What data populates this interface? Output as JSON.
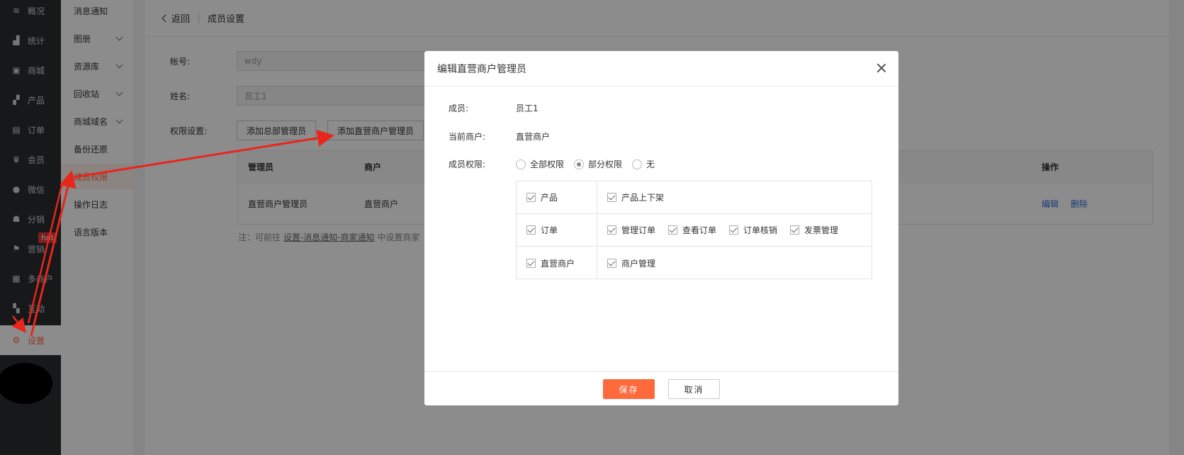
{
  "nav": {
    "items": [
      {
        "label": "概况",
        "icon": "layers-icon",
        "glyph": "≋"
      },
      {
        "label": "统计",
        "icon": "chart-icon",
        "glyph": "▟"
      },
      {
        "label": "商城",
        "icon": "shop-icon",
        "glyph": "▣"
      },
      {
        "label": "产品",
        "icon": "grid-icon",
        "glyph": "▞"
      },
      {
        "label": "订单",
        "icon": "clipboard-icon",
        "glyph": "▤"
      },
      {
        "label": "会员",
        "icon": "crown-icon",
        "glyph": "♛"
      },
      {
        "label": "微信",
        "icon": "wechat-icon",
        "glyph": "●"
      },
      {
        "label": "分销",
        "icon": "users-icon",
        "glyph": "☗"
      },
      {
        "label": "营销",
        "icon": "flag-icon",
        "glyph": "⚑"
      },
      {
        "label": "多商户",
        "icon": "stores-icon",
        "glyph": "▦"
      },
      {
        "label": "互动",
        "icon": "interact-icon",
        "glyph": "▚"
      },
      {
        "label": "设置",
        "icon": "gear-icon",
        "glyph": "⚙"
      }
    ],
    "hot_badge": "hot"
  },
  "subnav": {
    "items": [
      {
        "label": "消息通知"
      },
      {
        "label": "图册"
      },
      {
        "label": "资源库"
      },
      {
        "label": "回收站"
      },
      {
        "label": "商城域名"
      },
      {
        "label": "备份还原"
      },
      {
        "label": "成员权限"
      },
      {
        "label": "操作日志"
      },
      {
        "label": "语言版本"
      }
    ]
  },
  "topbar": {
    "back": "返回",
    "title": "成员设置"
  },
  "form": {
    "account_label": "帐号:",
    "account_value": "wdy",
    "name_label": "姓名:",
    "name_value": "员工1",
    "perm_label": "权限设置:",
    "btn_add_total": "添加总部管理员",
    "btn_add_direct": "添加直营商户管理员"
  },
  "table": {
    "headers": [
      "管理员",
      "商户",
      "操作"
    ],
    "row": {
      "admin": "直营商户管理员",
      "merchant": "直营商户",
      "edit": "编辑",
      "delete": "删除"
    }
  },
  "note": {
    "prefix": "注：可前往",
    "link": "设置-消息通知-商家通知",
    "suffix": "中设置商家"
  },
  "modal": {
    "title": "编辑直营商户管理员",
    "member_label": "成员:",
    "member_value": "员工1",
    "merchant_label": "当前商户:",
    "merchant_value": "直营商户",
    "perm_label": "成员权限:",
    "radios": [
      "全部权限",
      "部分权限",
      "无"
    ],
    "selected_radio": "部分权限",
    "permissions": [
      {
        "group": "产品",
        "items": [
          "产品上下架"
        ]
      },
      {
        "group": "订单",
        "items": [
          "管理订单",
          "查看订单",
          "订单核销",
          "发票管理"
        ]
      },
      {
        "group": "直营商户",
        "items": [
          "商户管理"
        ]
      }
    ],
    "save": "保存",
    "cancel": "取消"
  },
  "colors": {
    "accent": "#ff6a3d",
    "link": "#2f6cd8",
    "nav_bg": "#2b2d30",
    "arrow": "#e8261c"
  }
}
